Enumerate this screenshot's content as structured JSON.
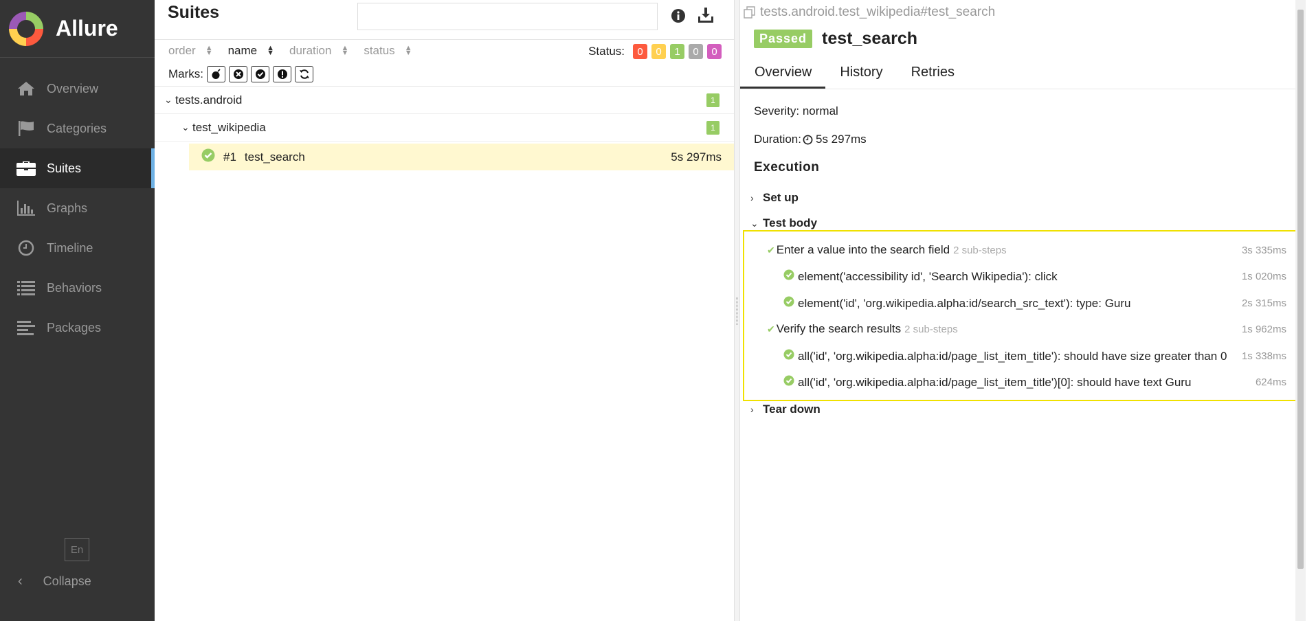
{
  "app": {
    "name": "Allure"
  },
  "sidebar": {
    "items": [
      {
        "label": "Overview",
        "icon": "home-icon"
      },
      {
        "label": "Categories",
        "icon": "flag-icon"
      },
      {
        "label": "Suites",
        "icon": "briefcase-icon",
        "active": true
      },
      {
        "label": "Graphs",
        "icon": "bar-chart-icon"
      },
      {
        "label": "Timeline",
        "icon": "clock-icon"
      },
      {
        "label": "Behaviors",
        "icon": "list-icon"
      },
      {
        "label": "Packages",
        "icon": "align-left-icon"
      }
    ],
    "language": "En",
    "collapse_label": "Collapse"
  },
  "suites": {
    "title": "Suites",
    "search_value": "",
    "sort": {
      "order": "order",
      "name": "name",
      "duration": "duration",
      "status": "status"
    },
    "status_label": "Status:",
    "status_counts": [
      {
        "value": "0",
        "color": "#fd5a3e"
      },
      {
        "value": "0",
        "color": "#ffd050"
      },
      {
        "value": "1",
        "color": "#97cc64"
      },
      {
        "value": "0",
        "color": "#aaaaaa"
      },
      {
        "value": "0",
        "color": "#d35ebe"
      }
    ],
    "marks_label": "Marks:",
    "tree": {
      "root": {
        "name": "tests.android",
        "count": "1"
      },
      "child": {
        "name": "test_wikipedia",
        "count": "1"
      },
      "leaf": {
        "number": "#1",
        "name": "test_search",
        "duration": "5s 297ms"
      }
    }
  },
  "detail": {
    "path": "tests.android.test_wikipedia#test_search",
    "status": "Passed",
    "name": "test_search",
    "tabs": [
      "Overview",
      "History",
      "Retries"
    ],
    "severity": "Severity: normal",
    "duration": "Duration: ",
    "duration_value": "5s 297ms",
    "execution_title": "Execution",
    "setup": "Set up",
    "test_body": "Test body",
    "teardown": "Tear down",
    "steps": [
      {
        "name": "Enter a value into the search field",
        "sub": "2 sub-steps",
        "duration": "3s 335ms"
      },
      {
        "name": "element('accessibility id', 'Search Wikipedia'): click",
        "duration": "1s 020ms"
      },
      {
        "name": "element('id', 'org.wikipedia.alpha:id/search_src_text'): type: Guru",
        "duration": "2s 315ms"
      },
      {
        "name": "Verify the search results",
        "sub": "2 sub-steps",
        "duration": "1s 962ms"
      },
      {
        "name": "all('id', 'org.wikipedia.alpha:id/page_list_item_title'): should have size greater than 0",
        "duration": "1s 338ms"
      },
      {
        "name": "all('id', 'org.wikipedia.alpha:id/page_list_item_title')[0]: should have text Guru",
        "duration": "624ms"
      }
    ]
  },
  "colors": {
    "passed": "#97cc64",
    "highlight_border": "#f0e100",
    "sidebar_bg": "#343434",
    "active_marker": "#6eb1e4"
  }
}
